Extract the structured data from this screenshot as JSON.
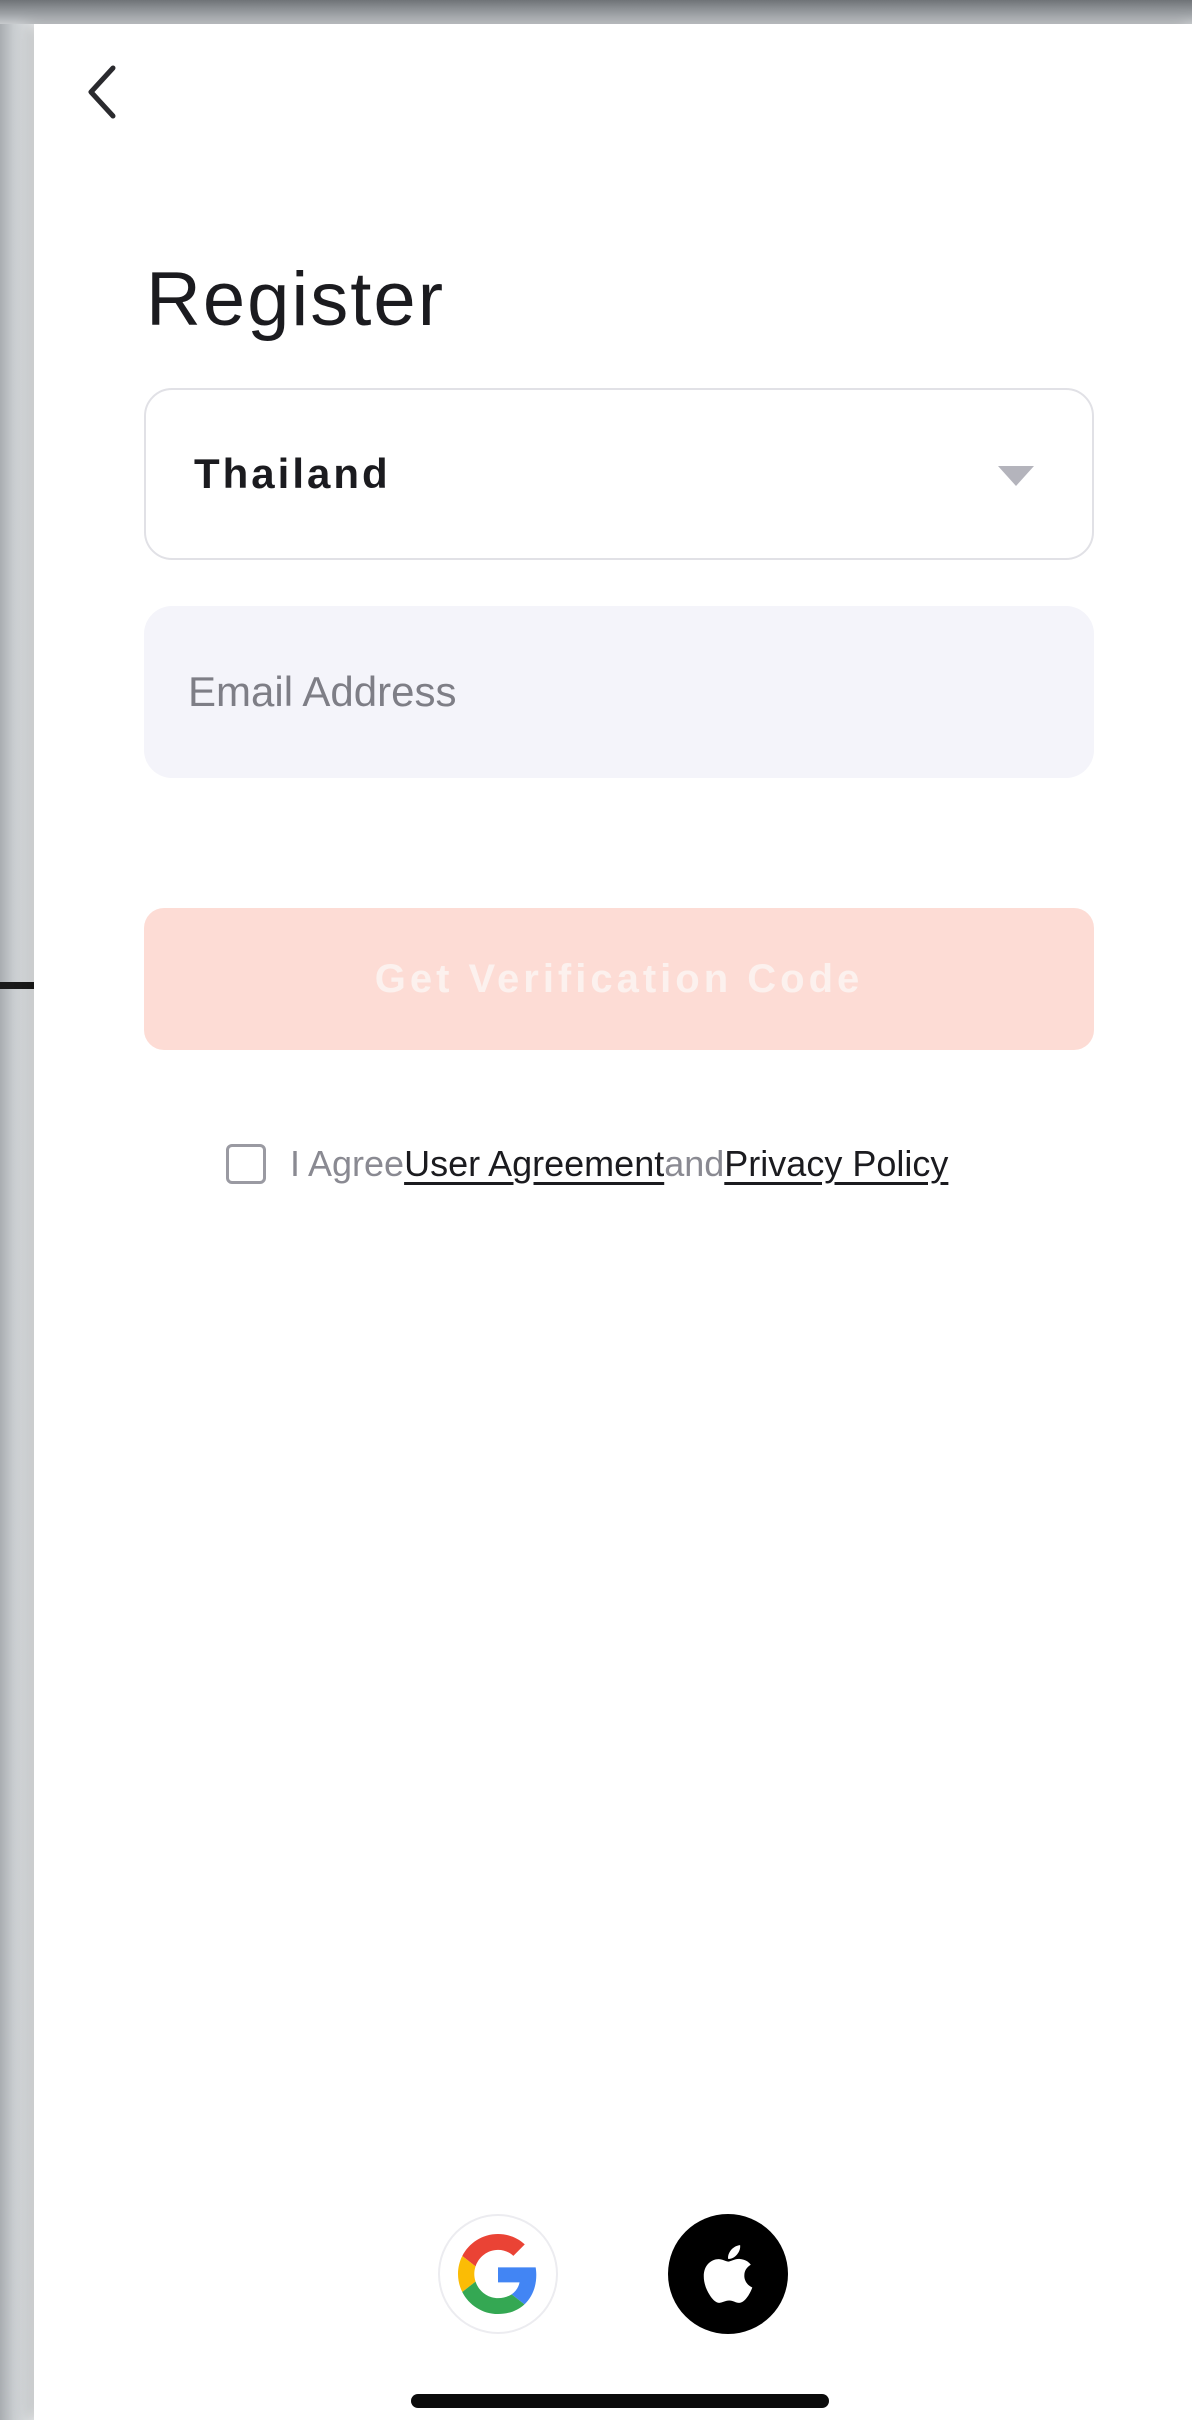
{
  "page": {
    "title": "Register"
  },
  "country_select": {
    "value": "Thailand"
  },
  "email": {
    "value": "",
    "placeholder": "Email Address"
  },
  "get_code_button": {
    "label": "Get Verification Code",
    "state": "disabled"
  },
  "agreement": {
    "checked": false,
    "prefix": "I Agree",
    "user_agreement_link": "User Agreement",
    "conjunction": "and",
    "privacy_policy_link": "Privacy Policy"
  },
  "social_login": [
    {
      "provider": "Google",
      "icon": "google-icon"
    },
    {
      "provider": "Apple",
      "icon": "apple-icon"
    }
  ],
  "icons": {
    "back": "chevron-left-icon",
    "dropdown": "caret-down-icon"
  },
  "colors": {
    "primary_disabled": "#fddcd5",
    "input_background": "#f4f4fa",
    "text_primary": "#1b1b1f",
    "text_muted": "#8a8a92"
  }
}
